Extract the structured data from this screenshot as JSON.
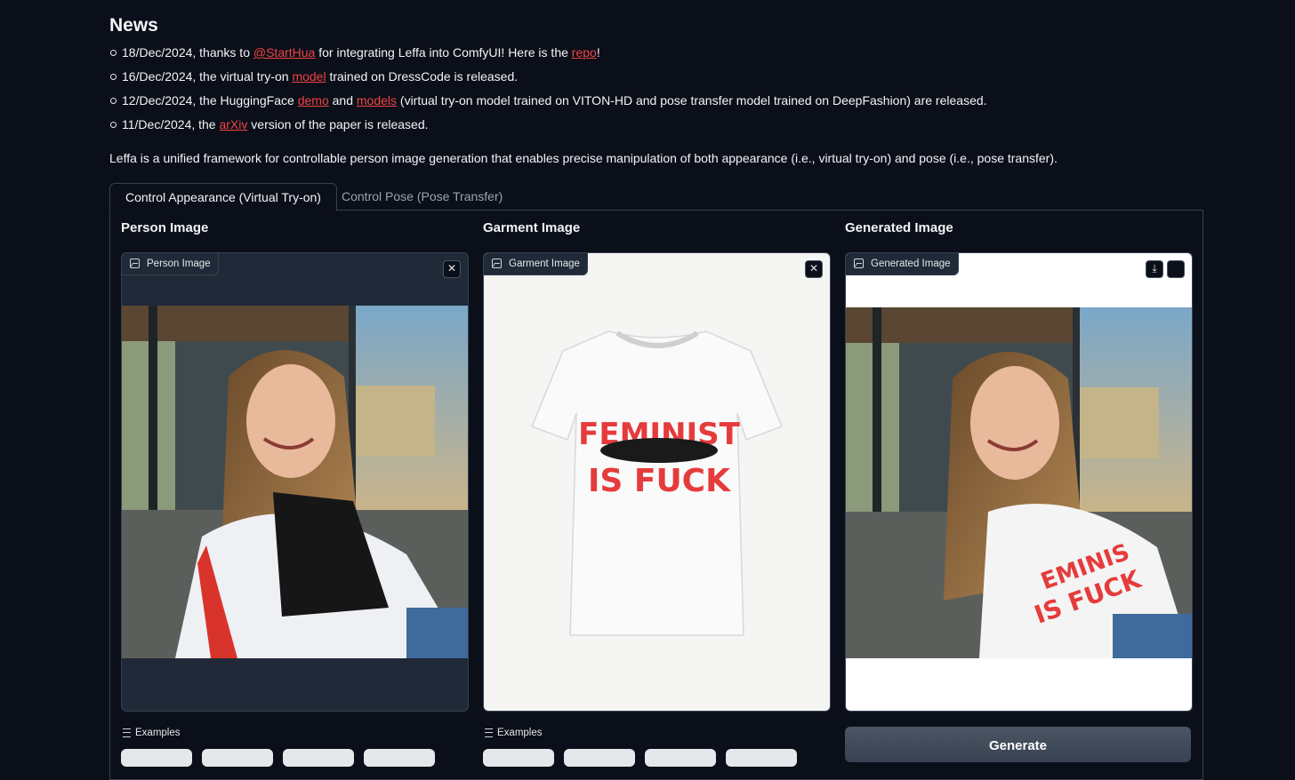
{
  "news": {
    "heading": "News",
    "items": [
      {
        "date": "18/Dec/2024, thanks to ",
        "link1": "@StartHua",
        "mid": " for integrating Leffa into ComfyUI! Here is the ",
        "link2": "repo",
        "end": "!"
      },
      {
        "date": "16/Dec/2024, the virtual try-on ",
        "link1": "model",
        "end": " trained on DressCode is released."
      },
      {
        "date": "12/Dec/2024, the HuggingFace ",
        "link1": "demo",
        "mid": " and ",
        "link2": "models",
        "end": " (virtual try-on model trained on VITON-HD and pose transfer model trained on DeepFashion) are released."
      },
      {
        "date": "11/Dec/2024, the ",
        "link1": "arXiv",
        "end": " version of the paper is released."
      }
    ]
  },
  "intro": "Leffa is a unified framework for controllable person image generation that enables precise manipulation of both appearance (i.e., virtual try-on) and pose (i.e., pose transfer).",
  "tabs": {
    "active": "Control Appearance (Virtual Try-on)",
    "inactive": "Control Pose (Pose Transfer)"
  },
  "columns": {
    "person": {
      "title": "Person Image",
      "label": "Person Image",
      "examples": "Examples"
    },
    "garment": {
      "title": "Garment Image",
      "label": "Garment Image",
      "examples": "Examples",
      "shirt_text_top": "FEMINIST",
      "shirt_text_bottom": "IS FUCK"
    },
    "generated": {
      "title": "Generated Image",
      "label": "Generated Image",
      "button": "Generate"
    }
  },
  "icons": {
    "clear": "close-icon",
    "download": "download-icon",
    "fullscreen": "fullscreen-icon",
    "image": "image-icon",
    "examples": "list-icon"
  },
  "colors": {
    "background": "#0b0f19",
    "link": "#ef4444",
    "border": "#374151"
  }
}
